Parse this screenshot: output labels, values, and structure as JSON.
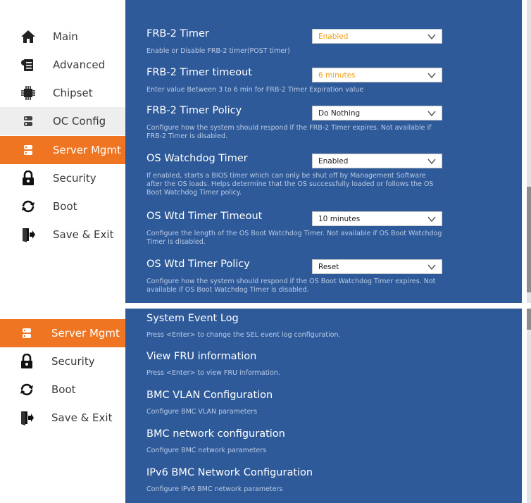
{
  "sidebar": {
    "items": [
      {
        "label": "Main",
        "icon": "home-icon"
      },
      {
        "label": "Advanced",
        "icon": "advanced-icon"
      },
      {
        "label": "Chipset",
        "icon": "chip-icon"
      },
      {
        "label": "OC Config",
        "icon": "oc-config-icon"
      },
      {
        "label": "Server Mgmt",
        "icon": "server-icon"
      },
      {
        "label": "Security",
        "icon": "lock-icon"
      },
      {
        "label": "Boot",
        "icon": "refresh-icon"
      },
      {
        "label": "Save & Exit",
        "icon": "exit-door-icon"
      }
    ]
  },
  "sidebar2": {
    "items": [
      {
        "label": "Server Mgmt",
        "icon": "server-icon"
      },
      {
        "label": "Security",
        "icon": "lock-icon"
      },
      {
        "label": "Boot",
        "icon": "refresh-icon"
      },
      {
        "label": "Save & Exit",
        "icon": "exit-door-icon"
      }
    ]
  },
  "settings": [
    {
      "title": "FRB-2 Timer",
      "value": "Enabled",
      "desc": "Enable or Disable FRB-2 timer(POST timer)"
    },
    {
      "title": "FRB-2 Timer timeout",
      "value": "6 minutes",
      "desc": "Enter value Between 3 to 6 min for FRB-2 Timer Expiration value"
    },
    {
      "title": "FRB-2 Timer Policy",
      "value": "Do Nothing",
      "desc": "Configure how the system should respond if the FRB-2 Timer expires. Not available if FRB-2 Timer is disabled."
    },
    {
      "title": "OS Watchdog Timer",
      "value": "Enabled",
      "desc": "If enabled, starts a BIOS timer which can only be shut off by Management Software after the OS loads.  Helps determine that the OS successfully loaded or follows the OS Boot Watchdog Timer policy."
    },
    {
      "title": "OS Wtd Timer Timeout",
      "value": "10 minutes",
      "desc": "Configure the length of the OS Boot Watchdog Timer.  Not available if OS Boot Watchdog Timer is disabled."
    },
    {
      "title": "OS Wtd Timer Policy",
      "value": "Reset",
      "desc": "Configure how the system should respond if the OS Boot Watchdog Timer expires. Not available if OS Boot Watchdog Timer is disabled."
    }
  ],
  "submenus": [
    {
      "title": "System Event Log",
      "desc": "Press <Enter> to change the SEL event log configuration."
    },
    {
      "title": "View FRU information",
      "desc": "Press <Enter> to view FRU information."
    },
    {
      "title": "BMC VLAN Configuration",
      "desc": "Configure BMC VLAN parameters"
    },
    {
      "title": "BMC network configuration",
      "desc": "Configure BMC network parameters"
    },
    {
      "title": "IPv6 BMC Network Configuration",
      "desc": "Configure IPv6 BMC network parameters"
    }
  ],
  "colors": {
    "accent": "#f07522",
    "main_bg": "#2f5a99",
    "warn_text": "#f39c12"
  }
}
